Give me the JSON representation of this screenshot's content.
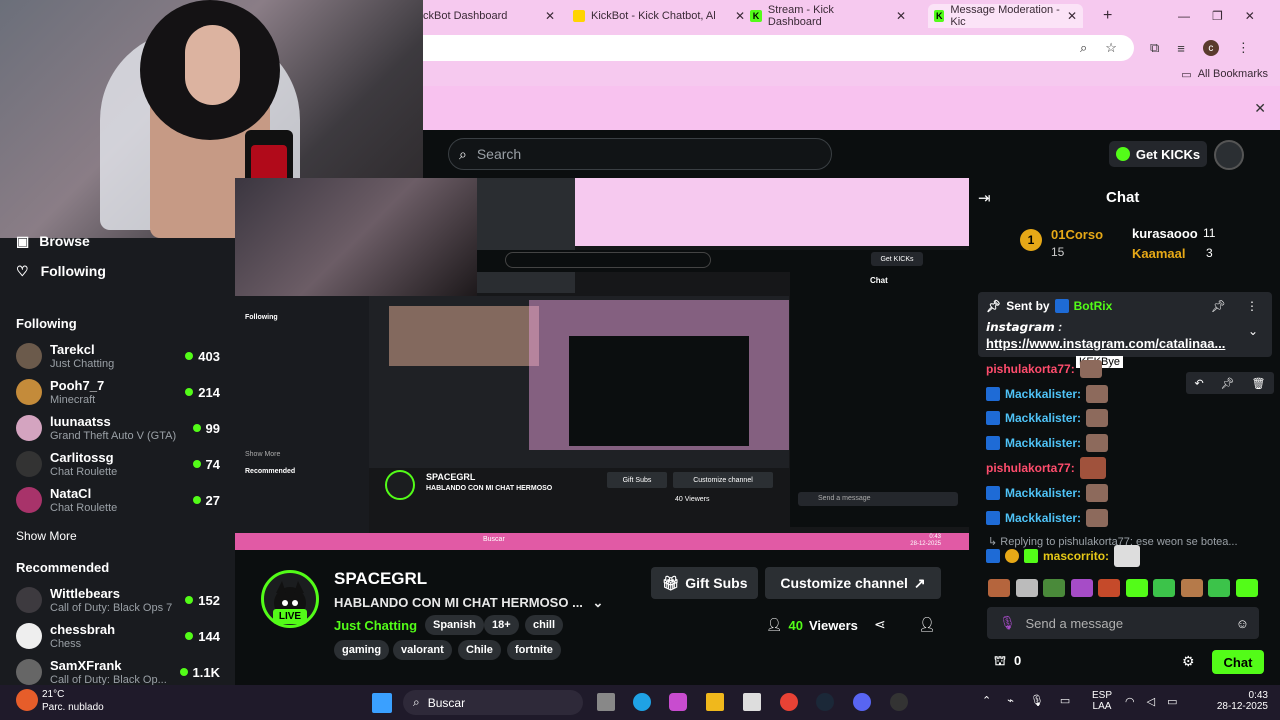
{
  "browser": {
    "tabs": [
      {
        "label": "ckBot Dashboard",
        "close": "✕"
      },
      {
        "label": "KickBot - Kick Chatbot, Al",
        "close": "✕"
      },
      {
        "label": "Stream - Kick Dashboard",
        "close": "✕"
      },
      {
        "label": "Message Moderation - Kic",
        "close": "✕"
      }
    ],
    "new_tab": "+",
    "bookmarks_label": "All Bookmarks",
    "avatar_letter": "c"
  },
  "topnav": {
    "search_placeholder": "Search",
    "get_kicks": "Get KICKs"
  },
  "sidebar": {
    "browse": "Browse",
    "following_nav": "Following",
    "following_title": "Following",
    "following": [
      {
        "name": "Tarekcl",
        "category": "Just Chatting",
        "viewers": "403"
      },
      {
        "name": "Pooh7_7",
        "category": "Minecraft",
        "viewers": "214"
      },
      {
        "name": "luunaatss",
        "category": "Grand Theft Auto V (GTA)",
        "viewers": "99"
      },
      {
        "name": "Carlitossg",
        "category": "Chat Roulette",
        "viewers": "74"
      },
      {
        "name": "NataCl",
        "category": "Chat Roulette",
        "viewers": "27"
      }
    ],
    "show_more": "Show More",
    "recommended_title": "Recommended",
    "recommended": [
      {
        "name": "Wittlebears",
        "category": "Call of Duty: Black Ops 7",
        "viewers": "152"
      },
      {
        "name": "chessbrah",
        "category": "Chess",
        "viewers": "144"
      },
      {
        "name": "SamXFrank",
        "category": "Call of Duty: Black Op...",
        "viewers": "1.1K"
      }
    ]
  },
  "stream": {
    "streamer": "SPACEGRL",
    "title": "HABLANDO CON MI CHAT HERMOSO ...",
    "category": "Just Chatting",
    "live": "LIVE",
    "tags_row1": [
      "Spanish",
      "18+",
      "chill"
    ],
    "tags_row2": [
      "gaming",
      "valorant",
      "Chile",
      "fortnite"
    ],
    "gift_subs": "Gift Subs",
    "customize": "Customize channel",
    "viewers": "40",
    "viewers_label": "Viewers"
  },
  "chat": {
    "title": "Chat",
    "leaders": [
      {
        "name": "01Corso",
        "count": "15"
      },
      {
        "name": "kurasaooo",
        "count": "11"
      },
      {
        "name": "Kaamaal",
        "count": "3"
      }
    ],
    "pinned": {
      "sent_by": "Sent by",
      "author": "BotRix",
      "line1": "𝙞𝙣𝙨𝙩𝙖𝙜𝙧𝙖𝙢 :",
      "link": "https://www.instagram.com/catalinaa..."
    },
    "tooltip": "KEKBye",
    "messages": [
      {
        "user": "pishulakorta77:",
        "color": "#ff4d6d"
      },
      {
        "user": "Mackkalister:",
        "color": "#4fc3f7"
      },
      {
        "user": "Mackkalister:",
        "color": "#4fc3f7"
      },
      {
        "user": "Mackkalister:",
        "color": "#4fc3f7"
      },
      {
        "user": "pishulakorta77:",
        "color": "#ff4d6d"
      },
      {
        "user": "Mackkalister:",
        "color": "#4fc3f7"
      },
      {
        "user": "Mackkalister:",
        "color": "#4fc3f7"
      }
    ],
    "reply_to": "Replying to pishulakorta77: ese weon se botea...",
    "reply_user": "mascorrito:",
    "input_placeholder": "Send a message",
    "points": "0",
    "chat_button": "Chat"
  },
  "taskbar": {
    "weather_temp": "21°C",
    "weather_desc": "Parc. nublado",
    "search": "Buscar",
    "lang1": "ESP",
    "lang2": "LAA",
    "time": "0:43",
    "date": "28-12-2025"
  },
  "nested": {
    "chat": "Chat",
    "get_kicks": "Get KICKs",
    "streamer": "SPACEGRL",
    "title": "HABLANDO CON MI CHAT HERMOSO",
    "gift": "Gift Subs",
    "customize": "Customize channel",
    "viewers": "40 Viewers",
    "send": "Send a message",
    "following": "Following",
    "recommended": "Recommended",
    "show_more": "Show More",
    "buscar": "Buscar",
    "time": "0:43",
    "date": "28-12-2025"
  },
  "colors": {
    "accent": "#53fc18",
    "chrome_pink": "#f6c9ef",
    "bg": "#0b0e0f",
    "sidebar": "#191b1f"
  }
}
